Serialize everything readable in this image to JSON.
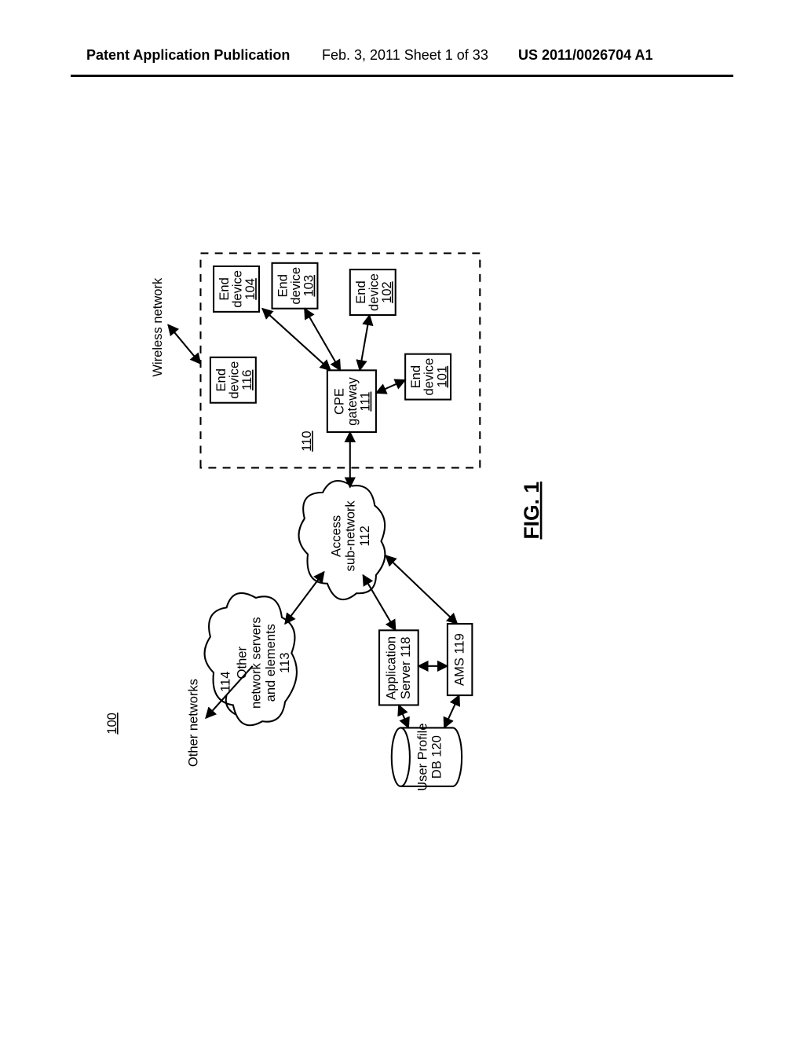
{
  "header": {
    "left": "Patent Application Publication",
    "mid": "Feb. 3, 2011  Sheet 1 of 33",
    "right": "US 2011/0026704 A1"
  },
  "figure": {
    "number": "100",
    "label": "FIG. 1",
    "nodes": {
      "other_networks": "Other networks",
      "wireless_network": "Wireless network",
      "other_servers_l1": "Other",
      "other_servers_l2": "network servers",
      "other_servers_l3": "and elements",
      "other_servers_ref": "113",
      "lead_ref": "114",
      "access_l1": "Access",
      "access_l2": "sub-network",
      "access_ref": "112",
      "app_server_l1": "Application",
      "app_server_l2": "Server 118",
      "ams": "AMS 119",
      "profile_l1": "User Profile",
      "profile_l2": "DB 120",
      "cpe_l1": "CPE",
      "cpe_l2": "gateway",
      "cpe_ref": "111",
      "premises_ref": "110",
      "end116_l1": "End",
      "end116_l2": "device",
      "end116_ref": "116",
      "end104_l1": "End",
      "end104_l2": "device",
      "end104_ref": "104",
      "end103_l1": "End",
      "end103_l2": "device",
      "end103_ref": "103",
      "end102_l1": "End",
      "end102_l2": "device",
      "end102_ref": "102",
      "end101_l1": "End",
      "end101_l2": "device",
      "end101_ref": "101"
    }
  }
}
